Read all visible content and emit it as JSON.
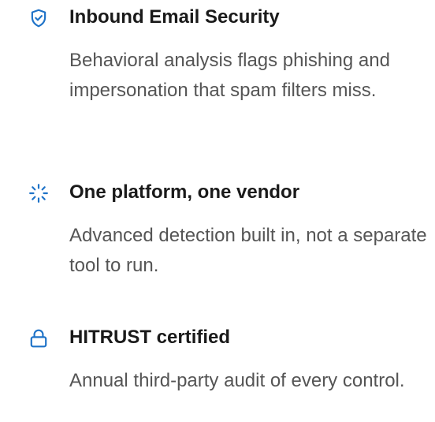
{
  "colors": {
    "accent": "#1f73c8",
    "title": "#1a1a1a",
    "body": "#555555"
  },
  "features": [
    {
      "icon": "shield-check-icon",
      "title": "Inbound Email Security",
      "description": "Behavioral analysis flags phishing and impersonation that spam filters miss."
    },
    {
      "icon": "sparkle-burst-icon",
      "title": "One platform, one vendor",
      "description": "Advanced detection built in, not a separate tool to run."
    },
    {
      "icon": "lock-icon",
      "title": "HITRUST certified",
      "description": "Annual third-party audit of every control."
    }
  ]
}
